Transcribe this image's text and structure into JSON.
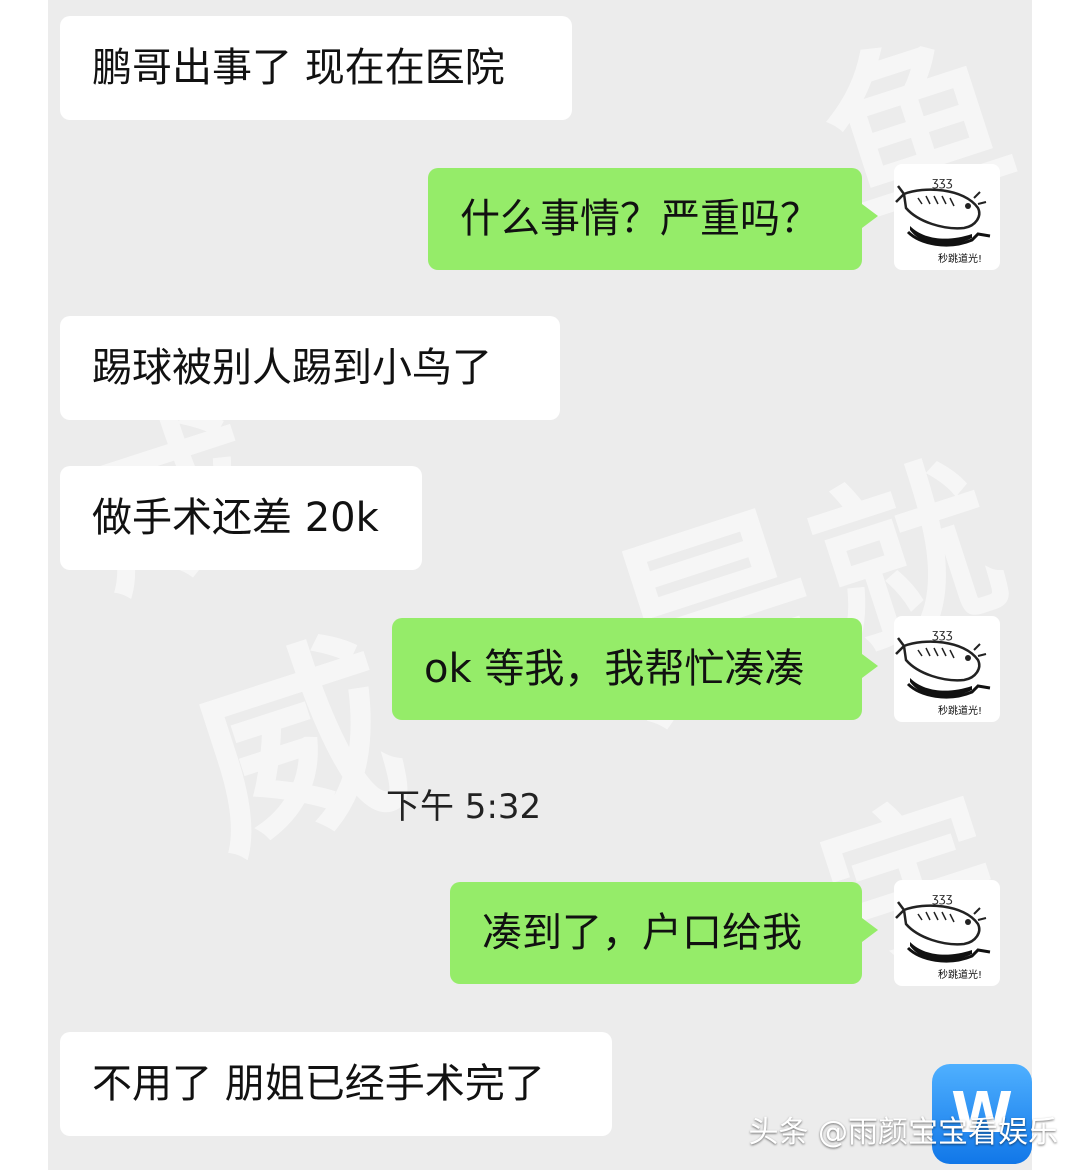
{
  "messages": [
    {
      "side": "left",
      "text": "鹏哥出事了 现在在医院"
    },
    {
      "side": "right",
      "text": "什么事情？严重吗？"
    },
    {
      "side": "left",
      "text": "踢球被别人踢到小鸟了"
    },
    {
      "side": "left",
      "text": "做手术还差 20k"
    },
    {
      "side": "right",
      "text": "ok 等我，我帮忙凑凑"
    },
    {
      "side": "right",
      "text": "凑到了，户口给我"
    },
    {
      "side": "left",
      "text": "不用了 朋姐已经手术完了"
    }
  ],
  "timestamp": "下午 5:32",
  "avatar": {
    "icon": "fish-in-wok-icon",
    "caption": "秒跳道光!"
  },
  "watermark": {
    "chars": [
      "就",
      "是",
      "威",
      "宇",
      "鱼",
      "咸"
    ]
  },
  "brand_badge": {
    "label": "W",
    "icon": "brand-logo-icon"
  },
  "source_caption": "头条 @雨颜宝宝看娱乐",
  "colors": {
    "chat_bg": "#ececec",
    "left_bubble": "#ffffff",
    "right_bubble": "#95ec69",
    "text": "#111111"
  }
}
